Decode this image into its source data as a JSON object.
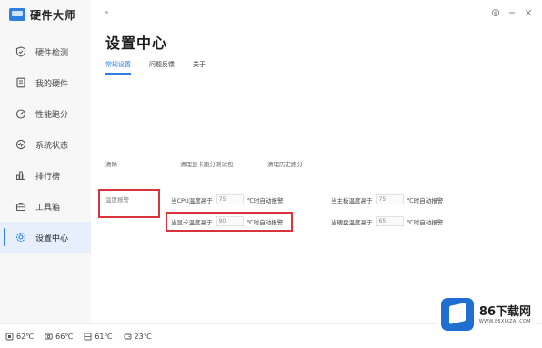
{
  "app": {
    "name": "硬件大师"
  },
  "sidebar": {
    "items": [
      {
        "label": "硬件检测",
        "icon": "shield-icon"
      },
      {
        "label": "我的硬件",
        "icon": "document-icon"
      },
      {
        "label": "性能跑分",
        "icon": "gauge-icon"
      },
      {
        "label": "系统状态",
        "icon": "monitor-icon"
      },
      {
        "label": "排行榜",
        "icon": "ranking-icon"
      },
      {
        "label": "工具箱",
        "icon": "toolbox-icon"
      },
      {
        "label": "设置中心",
        "icon": "settings-icon",
        "active": true
      }
    ]
  },
  "titlebar": {
    "icons": [
      "settings-icon",
      "minimize-icon",
      "close-icon"
    ]
  },
  "main": {
    "title": "设置中心",
    "tabs": [
      {
        "label": "常规设置",
        "active": true
      },
      {
        "label": "问题反馈"
      },
      {
        "label": "关于"
      }
    ],
    "options_row": {
      "col1": "清除",
      "col2": "清理显卡跑分测试包",
      "col3": "清理历史跑分"
    },
    "temperature_section": {
      "label": "温度报警",
      "alerts": [
        {
          "prefix": "当CPU温度高于",
          "value": "75",
          "suffix": "℃时自动报警"
        },
        {
          "prefix": "当主板温度高于",
          "value": "75",
          "suffix": "℃时自动报警"
        },
        {
          "prefix": "当显卡温度高于",
          "value": "90",
          "suffix": "℃时自动报警"
        },
        {
          "prefix": "当硬盘温度高于",
          "value": "65",
          "suffix": "℃时自动报警"
        }
      ]
    }
  },
  "statusbar": {
    "items": [
      {
        "icon": "cpu-temp-icon",
        "value": "62℃"
      },
      {
        "icon": "gpu-temp-icon",
        "value": "66℃"
      },
      {
        "icon": "board-temp-icon",
        "value": "61℃"
      },
      {
        "icon": "disk-temp-icon",
        "value": "23℃"
      }
    ]
  },
  "watermark": {
    "title": "86下载网",
    "subtitle": "WWW.86XIAZAI.COM"
  },
  "colors": {
    "accent": "#2f7fe0",
    "highlight": "#d9343b",
    "sidebar_bg": "#f7f7f7"
  }
}
